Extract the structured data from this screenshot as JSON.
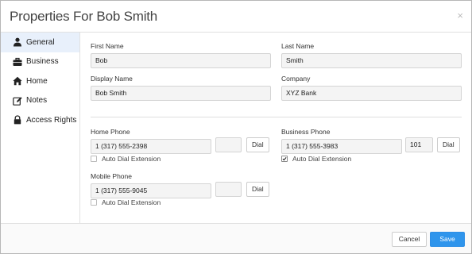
{
  "dialog": {
    "title": "Properties For Bob Smith",
    "close_symbol": "×"
  },
  "sidebar": {
    "items": [
      {
        "label": "General",
        "icon": "user-icon",
        "active": true
      },
      {
        "label": "Business",
        "icon": "briefcase-icon",
        "active": false
      },
      {
        "label": "Home",
        "icon": "home-icon",
        "active": false
      },
      {
        "label": "Notes",
        "icon": "edit-icon",
        "active": false
      },
      {
        "label": "Access Rights",
        "icon": "lock-icon",
        "active": false
      }
    ]
  },
  "form": {
    "first_name": {
      "label": "First Name",
      "value": "Bob"
    },
    "last_name": {
      "label": "Last Name",
      "value": "Smith"
    },
    "display_name": {
      "label": "Display Name",
      "value": "Bob Smith"
    },
    "company": {
      "label": "Company",
      "value": "XYZ Bank"
    },
    "home_phone": {
      "label": "Home Phone",
      "value": "1 (317) 555-2398",
      "extension": "",
      "dial": "Dial",
      "auto_dial_label": "Auto Dial Extension",
      "auto_dial": false
    },
    "business_phone": {
      "label": "Business Phone",
      "value": "1 (317) 555-3983",
      "extension": "101",
      "dial": "Dial",
      "auto_dial_label": "Auto Dial Extension",
      "auto_dial": true
    },
    "mobile_phone": {
      "label": "Mobile Phone",
      "value": "1 (317) 555-9045",
      "extension": "",
      "dial": "Dial",
      "auto_dial_label": "Auto Dial Extension",
      "auto_dial": false
    }
  },
  "footer": {
    "cancel_label": "Cancel",
    "save_label": "Save"
  },
  "colors": {
    "accent": "#2f95ec",
    "active_nav": "#e8f0fb"
  }
}
